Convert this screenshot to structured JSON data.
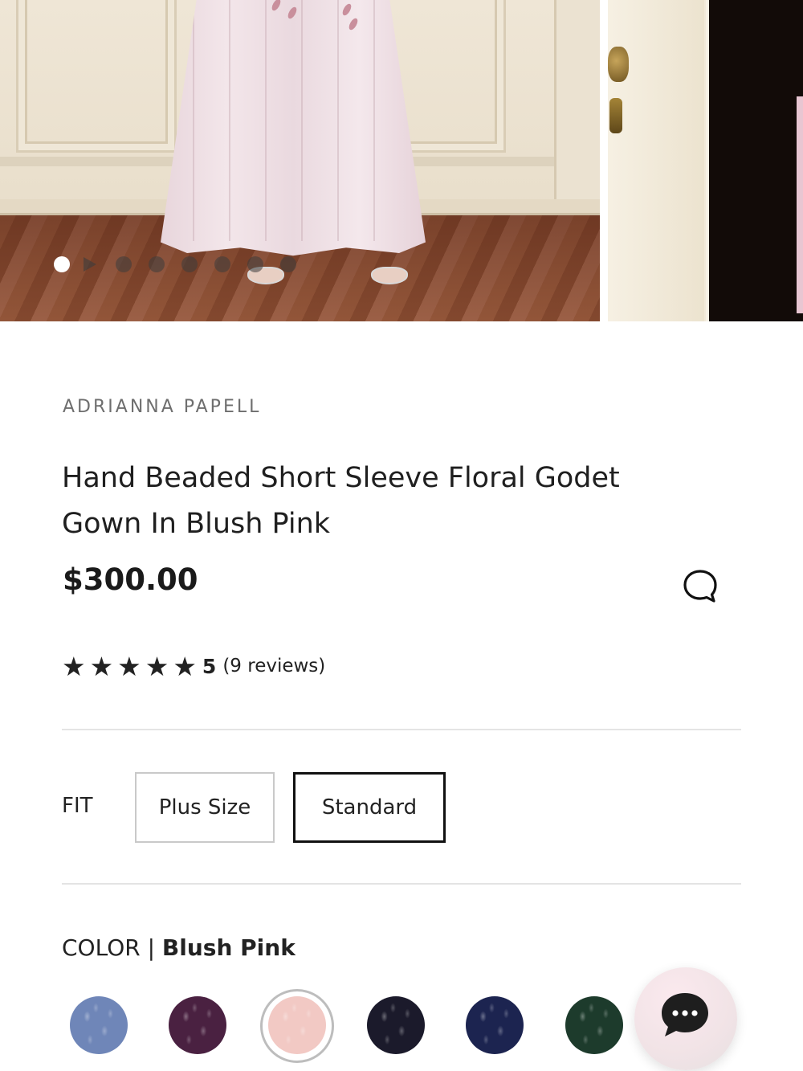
{
  "gallery": {
    "slide_count": 7,
    "active_slide": 1,
    "has_video": true
  },
  "product": {
    "brand": "ADRIANNA PAPELL",
    "title": "Hand Beaded Short Sleeve Floral Godet Gown In Blush Pink",
    "price": "$300.00",
    "rating": {
      "stars_glyphs": "★★★★★",
      "value": "5",
      "reviews_text": "(9 reviews)"
    }
  },
  "fit": {
    "label": "FIT",
    "options": [
      "Plus Size",
      "Standard"
    ],
    "selected": "Standard"
  },
  "color": {
    "label": "COLOR | ",
    "selected": "Blush Pink",
    "swatches": [
      {
        "color": "#6f86b8"
      },
      {
        "color": "#4a2141"
      },
      {
        "color": "#f2c9c4"
      },
      {
        "color": "#1b1a2b"
      },
      {
        "color": "#1c2450"
      },
      {
        "color": "#1d3b2c"
      }
    ]
  },
  "icons": {
    "chat_bubble": "speech-bubble-outline",
    "chat_fab": "ellipsis-chat"
  }
}
